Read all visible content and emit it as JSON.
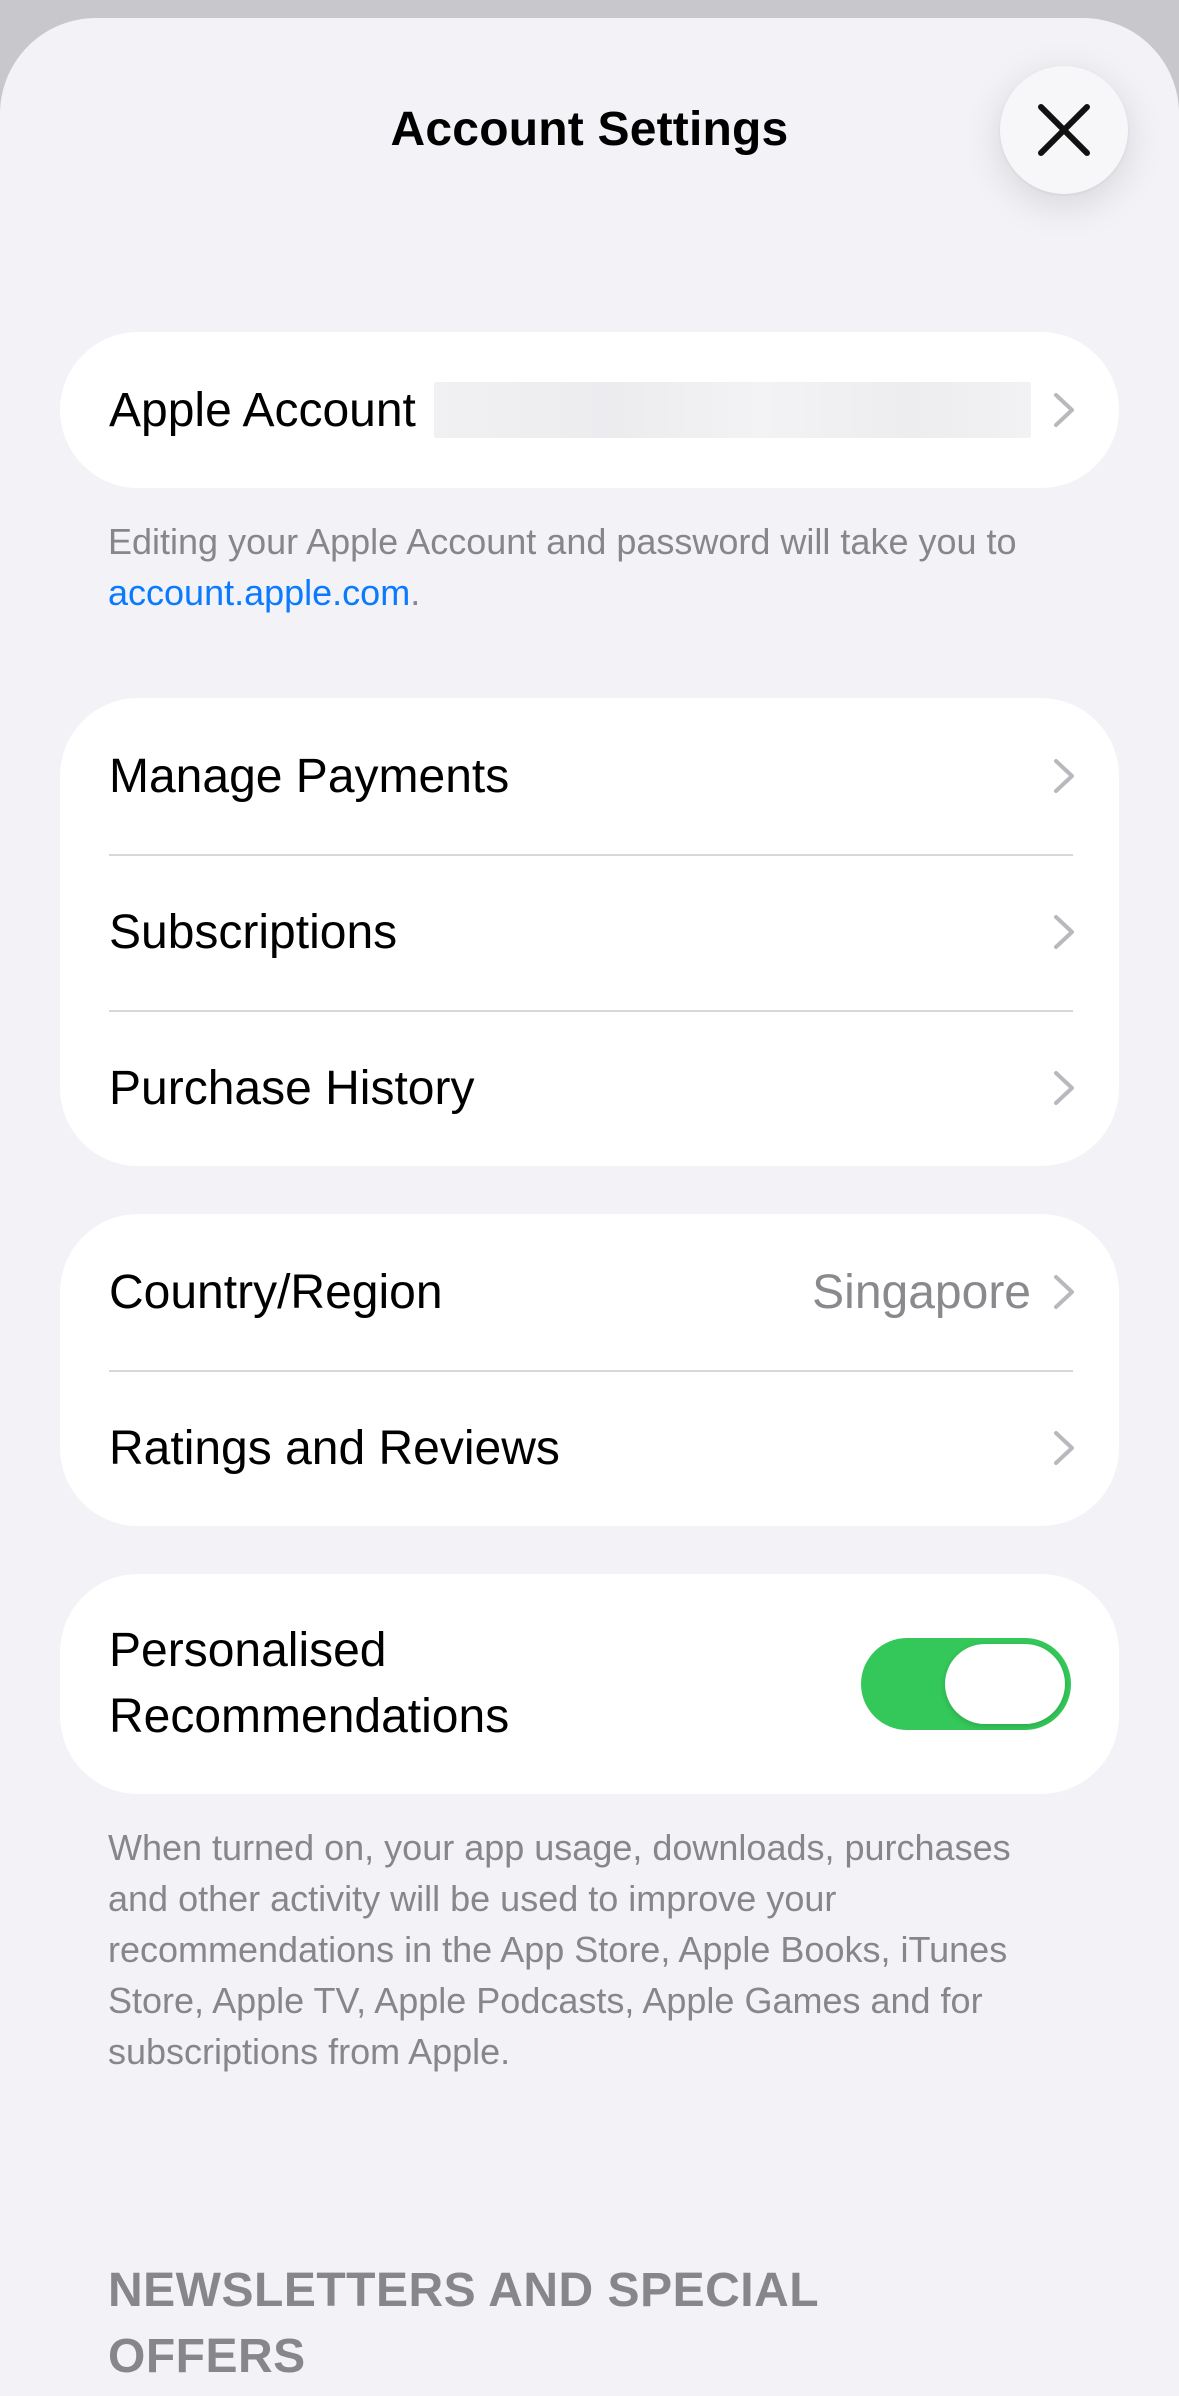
{
  "header": {
    "title": "Account Settings",
    "close_icon": "xmark-icon"
  },
  "apple_account": {
    "label": "Apple Account",
    "value_redacted": true
  },
  "apple_account_footer": {
    "text": "Editing your Apple Account and password will take you to ",
    "link": "account.apple.com",
    "suffix": "."
  },
  "payments_group": {
    "items": [
      {
        "label": "Manage Payments"
      },
      {
        "label": "Subscriptions"
      },
      {
        "label": "Purchase History"
      }
    ]
  },
  "region_group": {
    "country": {
      "label": "Country/Region",
      "value": "Singapore"
    },
    "ratings": {
      "label": "Ratings and Reviews"
    }
  },
  "personalised": {
    "label": "Personalised Recommendations",
    "enabled": true,
    "accent_color": "#34c759",
    "footer": "When turned on, your app usage, downloads, purchases and other activity will be used to improve your recommendations in the App Store, Apple Books, iTunes Store, Apple TV, Apple Podcasts, Apple Games and for subscriptions from Apple."
  },
  "newsletters": {
    "header": "NEWSLETTERS AND SPECIAL OFFERS"
  },
  "colors": {
    "link": "#0a7aff",
    "secondary_text": "#86868b",
    "background": "#f2f2f7"
  }
}
